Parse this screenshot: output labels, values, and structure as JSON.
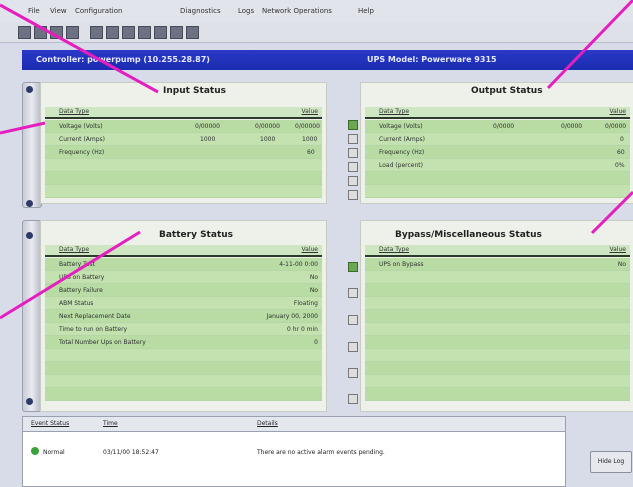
{
  "menu": [
    "File",
    "View",
    "Configuration",
    "Diagnostics",
    "Logs",
    "Network Operations",
    "Help"
  ],
  "title_bar": {
    "left": "Controller: powerpump (10.255.28.87)",
    "right": "UPS Model: Powerware 9315"
  },
  "panels": {
    "input": {
      "title": "Input Status",
      "columns": [
        "Data Type",
        "Value"
      ],
      "rows": [
        {
          "label": "Voltage (Volts)",
          "cols": [
            "0/00000",
            "0/00000",
            "0/00000"
          ]
        },
        {
          "label": "Current (Amps)",
          "cols": [
            "1000",
            "1000",
            "1000"
          ]
        },
        {
          "label": "Frequency (Hz)",
          "cols": [
            "",
            "",
            "60"
          ]
        }
      ]
    },
    "output": {
      "title": "Output Status",
      "columns": [
        "Data Type",
        "Value"
      ],
      "rows": [
        {
          "label": "Voltage (Volts)",
          "cols": [
            "0/0000",
            "0/0000",
            "0/0000"
          ]
        },
        {
          "label": "Current (Amps)",
          "cols": [
            "",
            "",
            "0"
          ]
        },
        {
          "label": "Frequency (Hz)",
          "cols": [
            "",
            "",
            "60"
          ]
        },
        {
          "label": "Load (percent)",
          "cols": [
            "",
            "",
            "0%"
          ]
        }
      ]
    },
    "battery": {
      "title": "Battery Status",
      "columns": [
        "Data Type",
        "Value"
      ],
      "rows": [
        {
          "label": "Battery Test",
          "value": "4-11-00 0:00"
        },
        {
          "label": "UPS on Battery",
          "value": "No"
        },
        {
          "label": "Battery Failure",
          "value": "No"
        },
        {
          "label": "ABM Status",
          "value": "Floating"
        },
        {
          "label": "Next Replacement Date",
          "value": "January 00, 2000"
        },
        {
          "label": "Time to run on Battery",
          "value": "0 hr 0 min"
        },
        {
          "label": "Total Number Ups on Battery",
          "value": "0"
        }
      ]
    },
    "bypass": {
      "title": "Bypass/Miscellaneous Status",
      "columns": [
        "Data Type",
        "Value"
      ],
      "rows": [
        {
          "label": "UPS on Bypass",
          "value": "No"
        }
      ]
    }
  },
  "status_area": {
    "columns": [
      "Event Status",
      "Time",
      "Details"
    ],
    "event_status": "Normal",
    "time": "03/11/00 18:52:47",
    "details": "There are no active alarm events pending.",
    "hide_button": "Hide Log"
  },
  "colors": {
    "title_bar": "#1f30b8",
    "panel_rows": "#b8dca4",
    "callout_lines": "#e51fbf"
  }
}
